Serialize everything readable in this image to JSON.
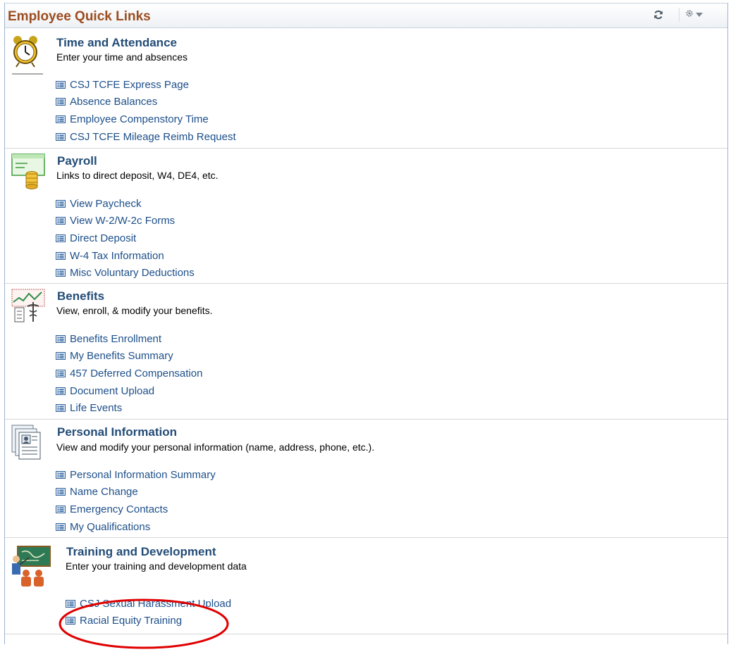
{
  "pagelet": {
    "title": "Employee Quick Links",
    "refresh_icon": "refresh-icon",
    "settings_icon": "gear-icon"
  },
  "sections": [
    {
      "title": "Time and Attendance",
      "description": "Enter your time and absences",
      "icon": "alarm-clock-icon",
      "links": [
        "CSJ TCFE Express Page",
        "Absence Balances",
        "Employee Compenstory Time",
        "CSJ TCFE Mileage Reimb Request"
      ]
    },
    {
      "title": "Payroll",
      "description": "Links to direct deposit, W4, DE4, etc.",
      "icon": "paycheck-coins-icon",
      "links": [
        "View Paycheck",
        "View W-2/W-2c Forms",
        "Direct Deposit",
        "W-4 Tax Information",
        "Misc Voluntary Deductions"
      ]
    },
    {
      "title": "Benefits",
      "description": "View, enroll, & modify your benefits.",
      "icon": "benefits-caduceus-icon",
      "links": [
        "Benefits Enrollment",
        "My Benefits Summary",
        "457 Deferred Compensation",
        "Document Upload",
        "Life Events"
      ]
    },
    {
      "title": "Personal Information",
      "description": "View and modify your personal information (name, address, phone, etc.).",
      "icon": "personal-record-icon",
      "links": [
        "Personal Information Summary",
        "Name Change",
        "Emergency Contacts",
        "My Qualifications"
      ]
    },
    {
      "title": "Training and Development",
      "description": "Enter your training and development data",
      "icon": "training-presentation-icon",
      "links": [
        "CSJ Sexual Harassment Upload",
        "Racial Equity Training"
      ]
    }
  ],
  "colors": {
    "header_title": "#9b4d1f",
    "section_title": "#234c77",
    "link": "#1d4f8a",
    "annotation": "#e00000"
  }
}
